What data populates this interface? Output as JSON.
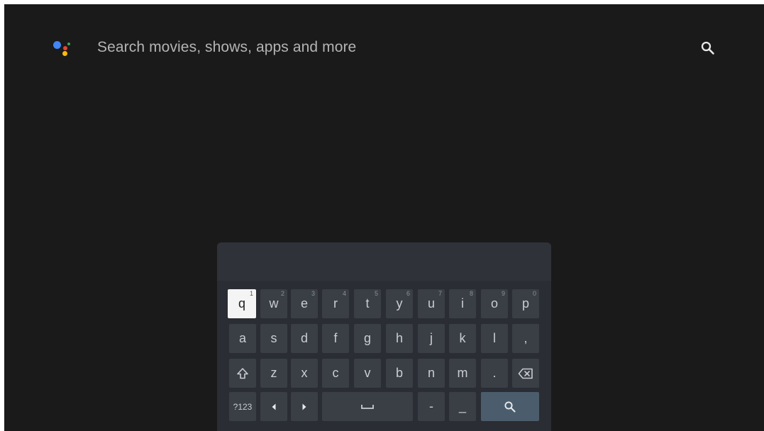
{
  "search": {
    "prompt": "Search movies, shows, apps and more",
    "search_icon": "search-icon"
  },
  "assistant": {
    "icon": "google-assistant-icon",
    "colors": [
      "#4285f4",
      "#ea4335",
      "#fbbc04",
      "#34a853"
    ]
  },
  "keyboard": {
    "row1": [
      {
        "label": "q",
        "hint": "1"
      },
      {
        "label": "w",
        "hint": "2"
      },
      {
        "label": "e",
        "hint": "3"
      },
      {
        "label": "r",
        "hint": "4"
      },
      {
        "label": "t",
        "hint": "5"
      },
      {
        "label": "y",
        "hint": "6"
      },
      {
        "label": "u",
        "hint": "7"
      },
      {
        "label": "i",
        "hint": "8"
      },
      {
        "label": "o",
        "hint": "9"
      },
      {
        "label": "p",
        "hint": "0"
      }
    ],
    "row2": [
      "a",
      "s",
      "d",
      "f",
      "g",
      "h",
      "j",
      "k",
      "l",
      ","
    ],
    "row3": [
      "z",
      "x",
      "c",
      "v",
      "b",
      "n",
      "m",
      "."
    ],
    "row4": {
      "symbols_label": "?123",
      "dash": "-",
      "underscore": "_"
    },
    "focused_key": "q",
    "icons": {
      "shift": "shift-icon",
      "backspace": "backspace-icon",
      "left": "arrow-left-icon",
      "right": "arrow-right-icon",
      "space": "space-icon",
      "search": "search-icon"
    },
    "action_color": "#4b5d6d"
  }
}
